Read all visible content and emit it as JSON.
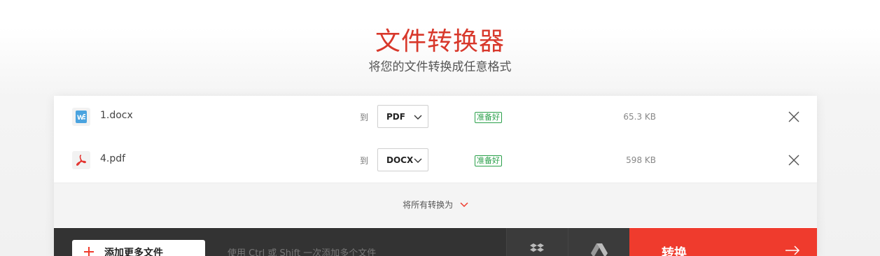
{
  "header": {
    "title": "文件转换器",
    "subtitle": "将您的文件转换成任意格式"
  },
  "files": [
    {
      "name": "1.docx",
      "icon": "word-doc-icon",
      "to_label": "到",
      "format": "PDF",
      "status": "准备好",
      "size": "65.3 KB"
    },
    {
      "name": "4.pdf",
      "icon": "pdf-icon",
      "to_label": "到",
      "format": "DOCX",
      "status": "准备好",
      "size": "598 KB"
    }
  ],
  "convert_all": {
    "label": "将所有转换为"
  },
  "toolbar": {
    "add_files_label": "添加更多文件",
    "hint": "使用 Ctrl 或 Shift 一次添加多个文件",
    "convert_label": "转换"
  },
  "colors": {
    "brand": "#d8382b",
    "convert_button": "#ef3b2d",
    "status_ready": "#2aa04a",
    "bottom_bar": "#333333"
  }
}
